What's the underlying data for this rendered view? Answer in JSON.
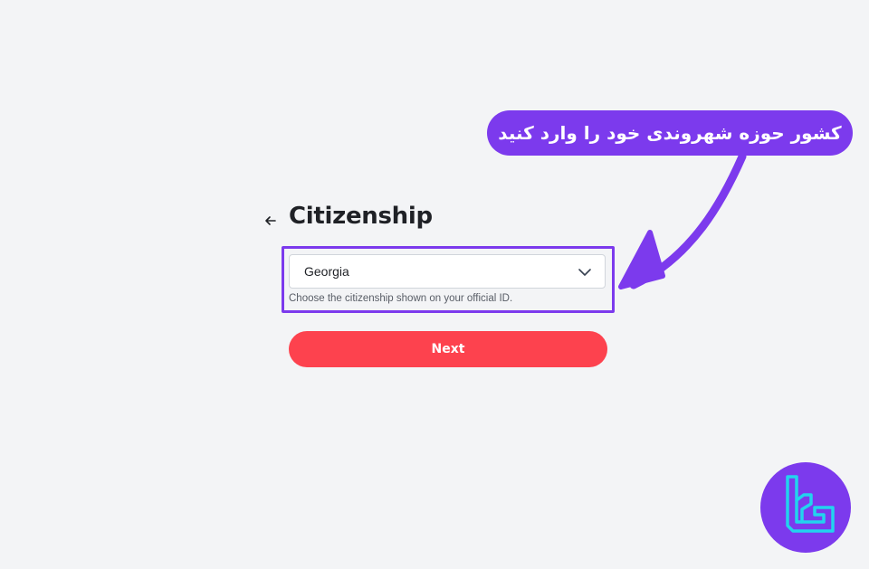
{
  "page": {
    "title": "Citizenship"
  },
  "citizenship_select": {
    "selected_value": "Georgia",
    "helper_text": "Choose the citizenship shown on your official ID."
  },
  "actions": {
    "next_label": "Next"
  },
  "annotation": {
    "callout_text": "کشور حوزه شهروندی خود را وارد کنید"
  },
  "icons": {
    "back": "arrow-left-icon",
    "dropdown": "chevron-down-icon",
    "logo": "tc-logo-icon"
  },
  "colors": {
    "background": "#f3f4f6",
    "accent_purple": "#7c3aed",
    "button_red": "#fd424e",
    "text_dark": "#1f2126",
    "logo_cyan": "#22d3ee"
  }
}
